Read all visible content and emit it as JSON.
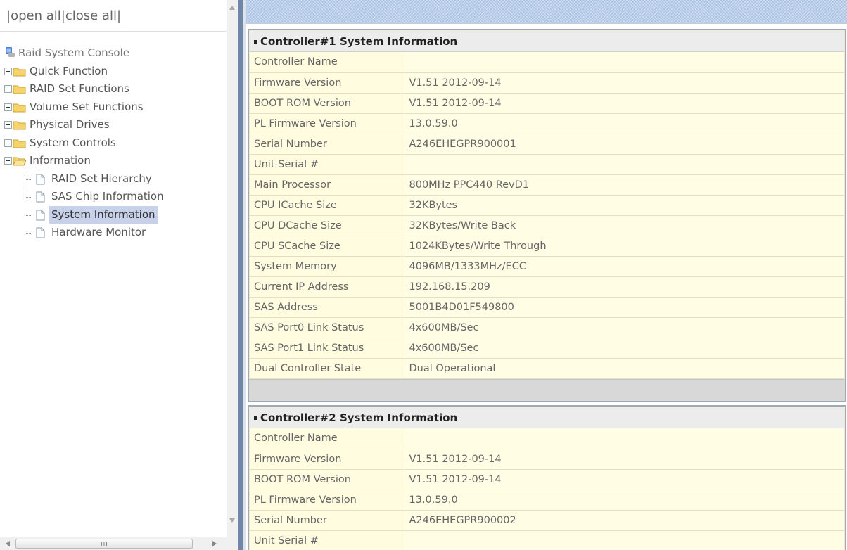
{
  "tree_controls": {
    "sep1": "|",
    "open_all": "open all",
    "sep2": "|",
    "close_all": "close all",
    "sep3": "|"
  },
  "tree": {
    "root": "Raid System Console",
    "folders": [
      {
        "label": "Quick Function",
        "expanded": false
      },
      {
        "label": "RAID Set Functions",
        "expanded": false
      },
      {
        "label": "Volume Set Functions",
        "expanded": false
      },
      {
        "label": "Physical Drives",
        "expanded": false
      },
      {
        "label": "System Controls",
        "expanded": false
      },
      {
        "label": "Information",
        "expanded": true
      }
    ],
    "information_items": [
      {
        "label": "RAID Set Hierarchy",
        "selected": false
      },
      {
        "label": "SAS Chip Information",
        "selected": false
      },
      {
        "label": "System Information",
        "selected": true
      },
      {
        "label": "Hardware Monitor",
        "selected": false
      }
    ]
  },
  "scrollbar": {
    "grip": "III"
  },
  "panels": [
    {
      "title": "Controller#1 System Information",
      "rows": [
        [
          "Controller Name",
          ""
        ],
        [
          "Firmware Version",
          "V1.51 2012-09-14"
        ],
        [
          "BOOT ROM Version",
          "V1.51 2012-09-14"
        ],
        [
          "PL Firmware Version",
          "13.0.59.0"
        ],
        [
          "Serial Number",
          "A246EHEGPR900001"
        ],
        [
          "Unit Serial #",
          ""
        ],
        [
          "Main Processor",
          "800MHz PPC440 RevD1"
        ],
        [
          "CPU ICache Size",
          "32KBytes"
        ],
        [
          "CPU DCache Size",
          "32KBytes/Write Back"
        ],
        [
          "CPU SCache Size",
          "1024KBytes/Write Through"
        ],
        [
          "System Memory",
          "4096MB/1333MHz/ECC"
        ],
        [
          "Current IP Address",
          "192.168.15.209"
        ],
        [
          "SAS Address",
          "5001B4D01F549800"
        ],
        [
          "SAS Port0 Link Status",
          "4x600MB/Sec"
        ],
        [
          "SAS Port1 Link Status",
          "4x600MB/Sec"
        ],
        [
          "Dual Controller State",
          "Dual Operational"
        ]
      ]
    },
    {
      "title": "Controller#2 System Information",
      "rows": [
        [
          "Controller Name",
          ""
        ],
        [
          "Firmware Version",
          "V1.51 2012-09-14"
        ],
        [
          "BOOT ROM Version",
          "V1.51 2012-09-14"
        ],
        [
          "PL Firmware Version",
          "13.0.59.0"
        ],
        [
          "Serial Number",
          "A246EHEGPR900002"
        ],
        [
          "Unit Serial #",
          ""
        ]
      ]
    }
  ],
  "colors": {
    "splitter": "#6f87a7",
    "panel_bg": "#fffddd",
    "selected_bg": "#c7d2ea",
    "topbar": "#a9c2e4"
  },
  "icons": {
    "root": "console-icon",
    "folder": "folder-icon",
    "page": "document-icon"
  }
}
